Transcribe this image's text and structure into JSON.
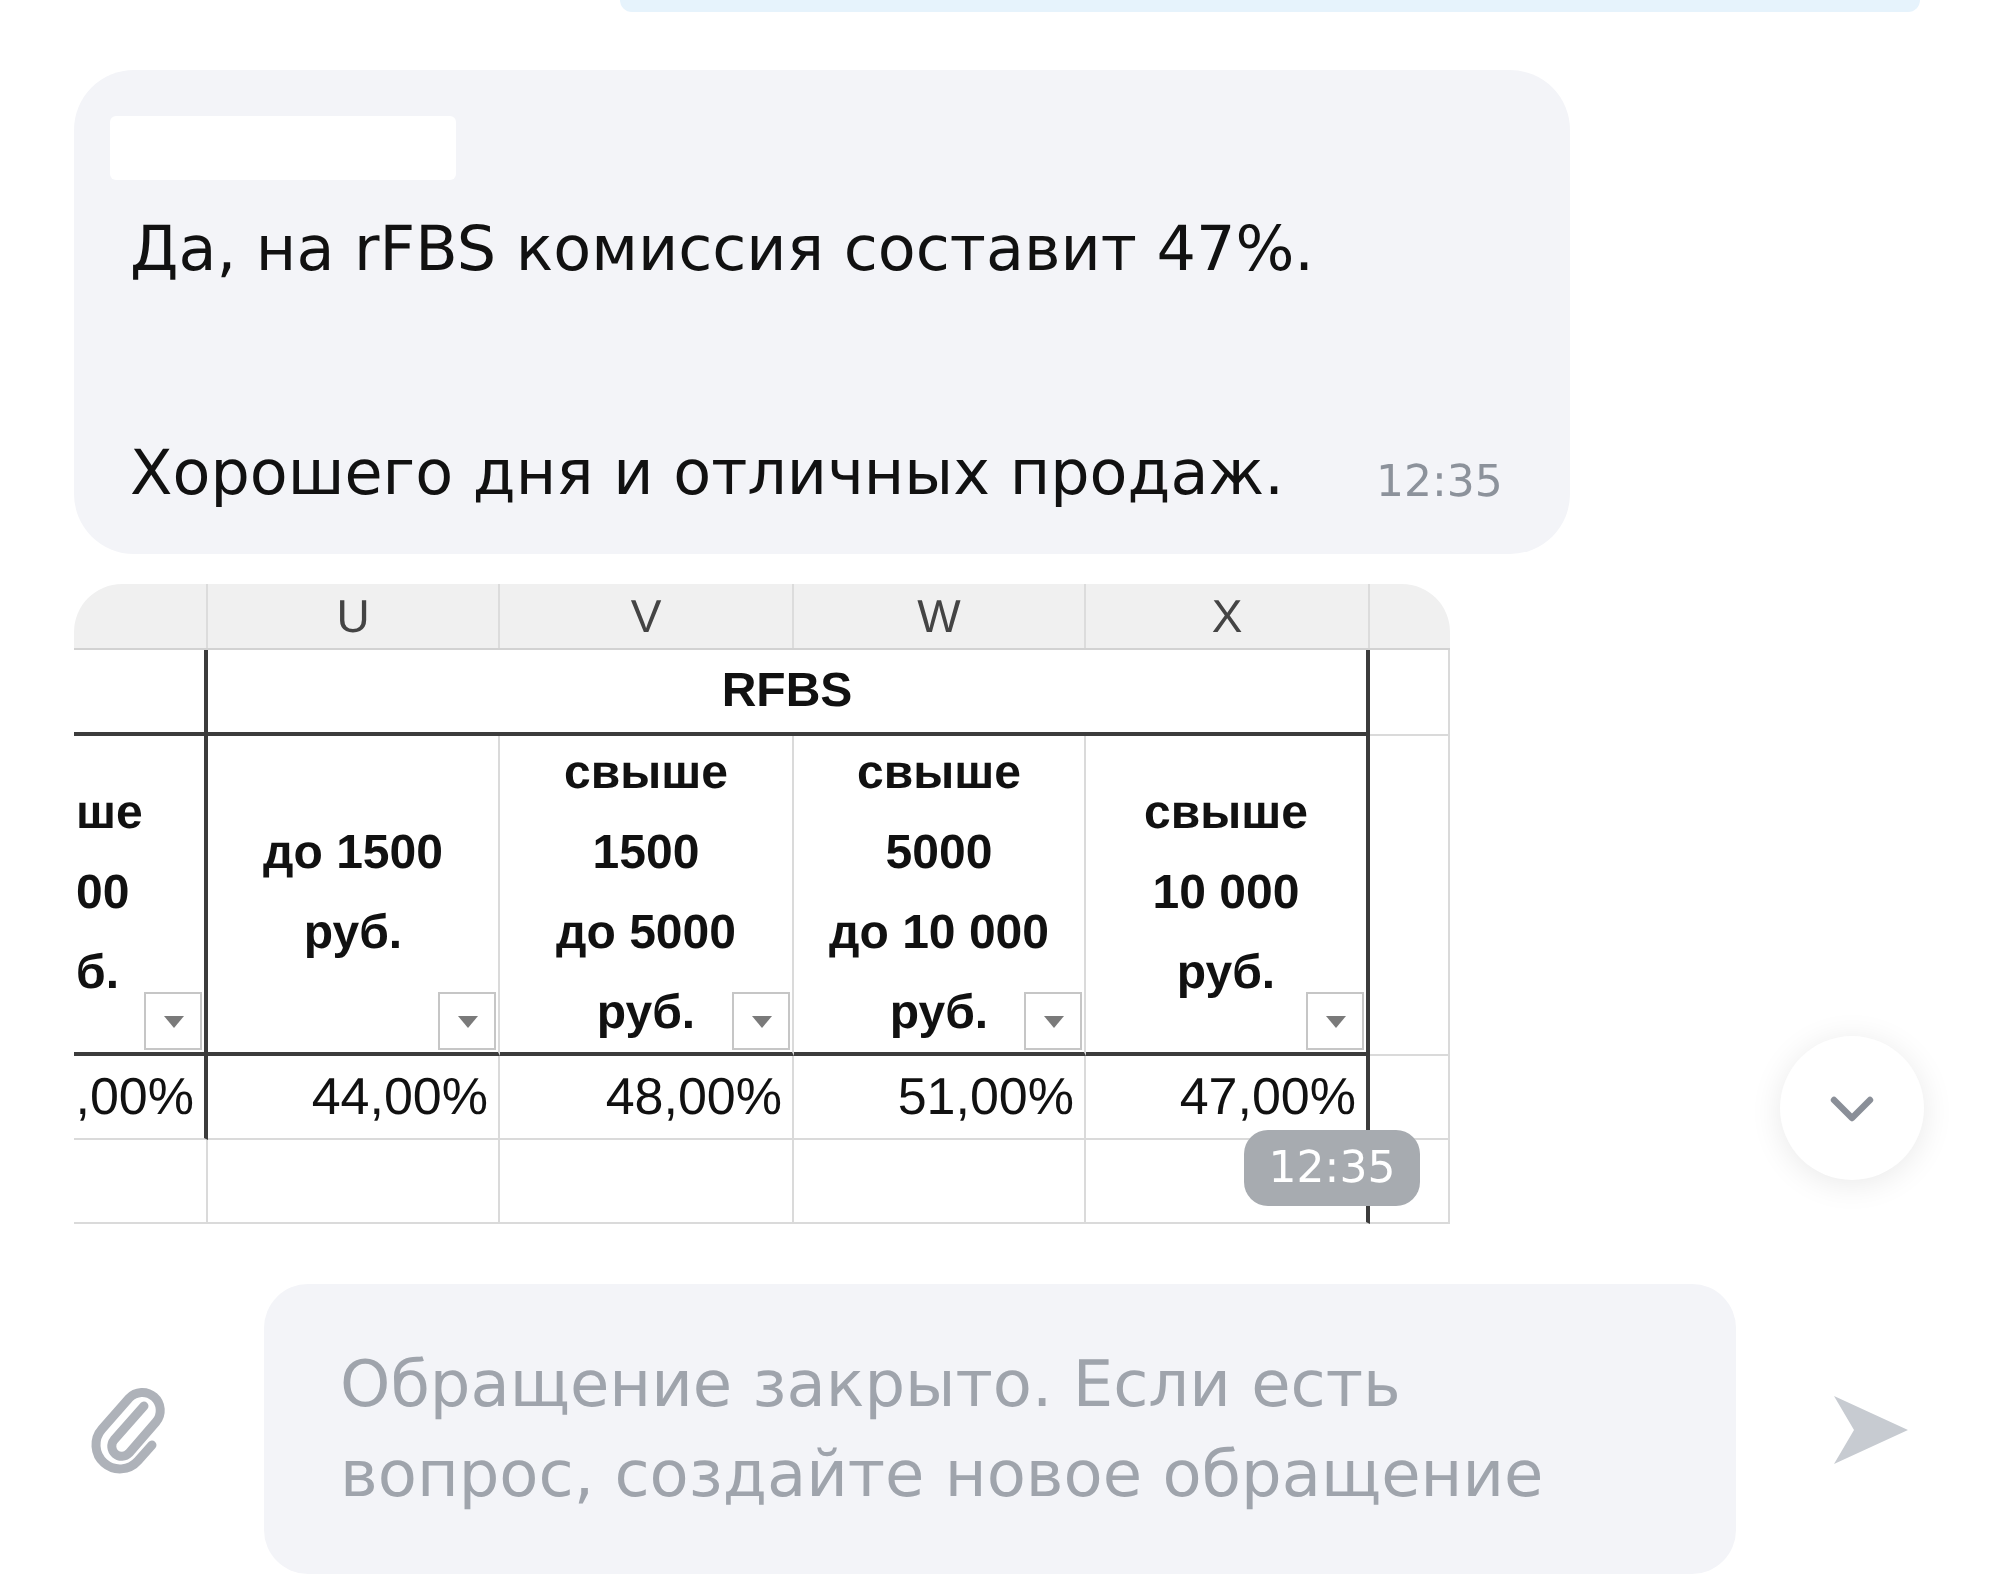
{
  "messages": [
    {
      "kind": "text",
      "paragraphs": [
        "Да, на rFBS комиссия составит 47%.",
        "Хорошего дня и отличных продаж."
      ],
      "time": "12:35"
    },
    {
      "kind": "spreadsheet",
      "column_letters": [
        "U",
        "V",
        "W",
        "X"
      ],
      "group_header": "RFBS",
      "headers": [
        {
          "lines": [
            "ше",
            "00",
            "б."
          ]
        },
        {
          "lines": [
            "до 1500",
            "руб."
          ]
        },
        {
          "lines": [
            "свыше",
            "1500",
            "до 5000",
            "руб."
          ]
        },
        {
          "lines": [
            "свыше",
            "5000",
            "до 10 000",
            "руб."
          ]
        },
        {
          "lines": [
            "свыше",
            "10 000",
            "руб."
          ]
        }
      ],
      "rows": [
        [
          ",00%",
          "44,00%",
          "48,00%",
          "51,00%",
          "47,00%"
        ]
      ],
      "time": "12:35"
    }
  ],
  "composer": {
    "placeholder": "Обращение закрыто. Если есть вопрос, создайте новое обращение"
  }
}
